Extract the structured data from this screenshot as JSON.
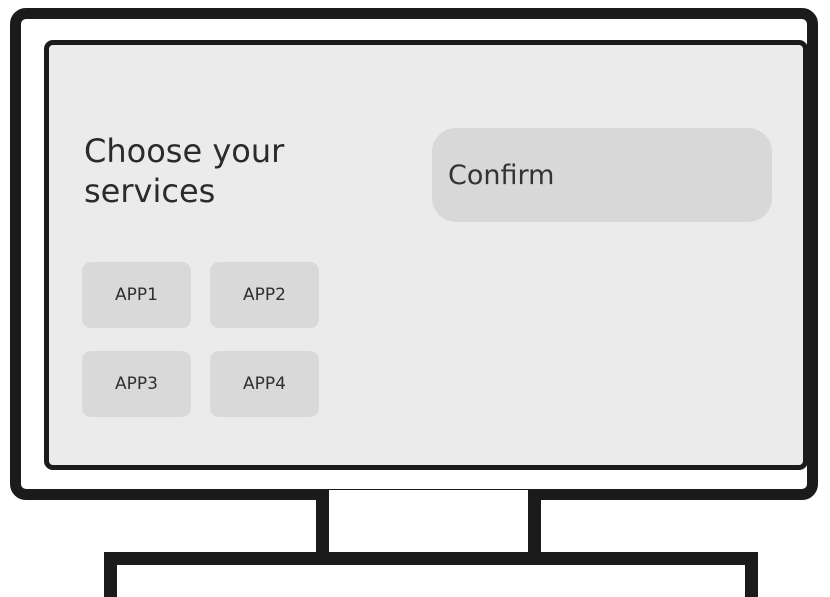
{
  "screen": {
    "heading": "Choose your services",
    "confirm_label": "Confirm",
    "apps": [
      {
        "label": "APP1"
      },
      {
        "label": "APP2"
      },
      {
        "label": "APP3"
      },
      {
        "label": "APP4"
      }
    ]
  },
  "colors": {
    "screen_bg": "#ebebeb",
    "tile_bg": "#d9d9d9",
    "button_bg": "#d8d8d8",
    "outline": "#1b1b1b"
  }
}
